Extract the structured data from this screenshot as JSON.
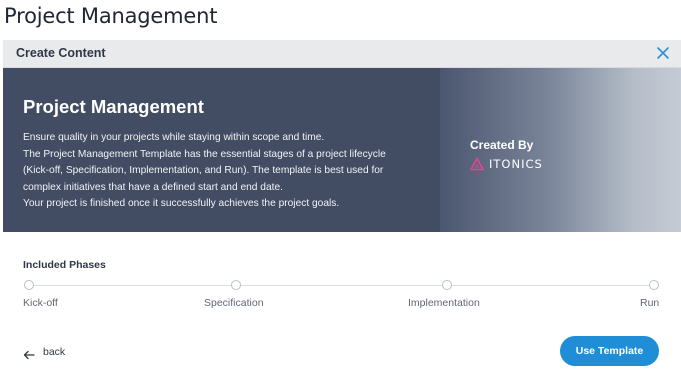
{
  "page": {
    "title": "Project Management"
  },
  "modal": {
    "header_title": "Create Content",
    "close_icon": "close-icon"
  },
  "hero": {
    "title": "Project Management",
    "description_lines": [
      "Ensure quality in your projects while staying within scope and time.",
      "The Project Management Template has the essential stages of a project lifecycle",
      "(Kick-off, Specification, Implementation, and Run). The template is best used for",
      "complex initiatives that have a defined start and end date.",
      "Your project is finished once it successfully achieves the project goals."
    ],
    "created_by_label": "Created By",
    "brand_name": "ITONICS",
    "brand_color": "#e4458b"
  },
  "phases": {
    "label": "Included Phases",
    "items": [
      {
        "label": "Kick-off"
      },
      {
        "label": "Specification"
      },
      {
        "label": "Implementation"
      },
      {
        "label": "Run"
      }
    ]
  },
  "footer": {
    "back_label": "back",
    "use_template_label": "Use Template",
    "accent_color": "#1f8ed6"
  }
}
